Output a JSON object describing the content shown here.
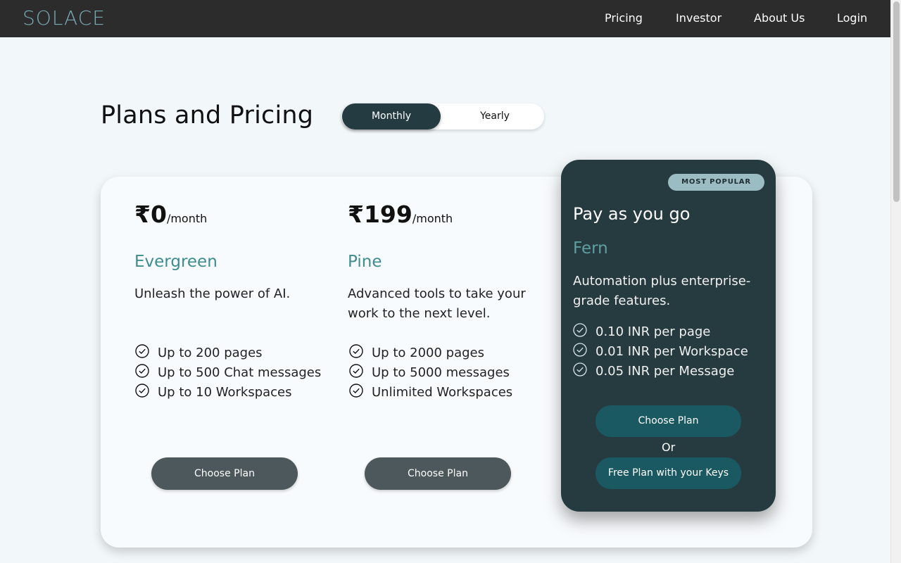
{
  "nav": {
    "logo": "SOLACE",
    "links": [
      "Pricing",
      "Investor",
      "About Us",
      "Login"
    ]
  },
  "page": {
    "title": "Plans and Pricing"
  },
  "billing_toggle": {
    "options": [
      "Monthly",
      "Yearly"
    ],
    "selected": "Monthly"
  },
  "plans": [
    {
      "currency": "₹",
      "price": "0",
      "period": "/month",
      "name": "Evergreen",
      "description": "Unleash the power of AI.",
      "features": [
        "Up to 200 pages",
        "Up to 500 Chat messages",
        "Up to 10 Workspaces"
      ],
      "button": "Choose Plan"
    },
    {
      "currency": "₹",
      "price": "199",
      "period": "/month",
      "name": "Pine",
      "description": "Advanced tools to take your work to the next level.",
      "features": [
        "Up to 2000 pages",
        "Up to 5000 messages",
        "Unlimited Workspaces"
      ],
      "button": "Choose Plan"
    }
  ],
  "featured_plan": {
    "badge": "MOST POPULAR",
    "title": "Pay as you go",
    "name": "Fern",
    "description": "Automation plus enterprise-grade features.",
    "features": [
      "0.10 INR per page",
      "0.01 INR per Workspace",
      "0.05 INR per Message"
    ],
    "primary_button": "Choose Plan",
    "or_text": "Or",
    "secondary_button": "Free Plan with your Keys"
  },
  "colors": {
    "nav_bg": "#2c2c2c",
    "logo": "#77a9b4",
    "accent_teal": "#3f8c8f",
    "featured_bg": "#263b40",
    "teal_button": "#1b5962",
    "grey_button": "#4c585c",
    "badge_bg": "#9cbcc4"
  },
  "icons": {
    "feature_check": "check-circle-icon"
  }
}
